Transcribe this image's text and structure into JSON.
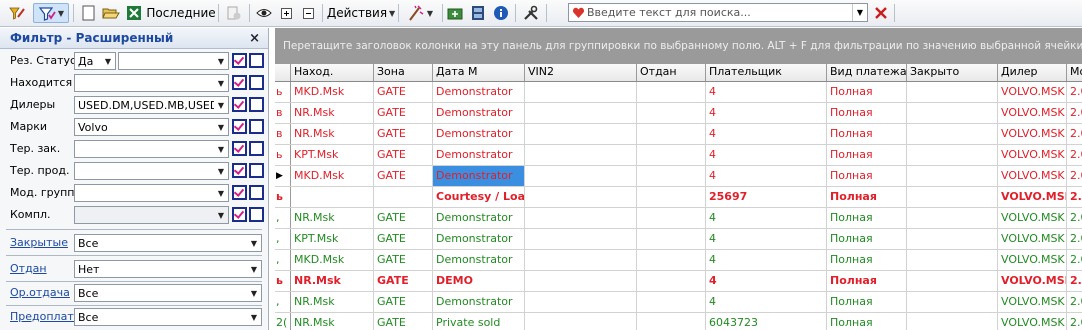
{
  "toolbar": {
    "recent_label": "Последние",
    "actions_label": "Действия",
    "search_placeholder": "Введите текст для поиска..."
  },
  "filter_panel": {
    "title": "Фильтр - Расширенный",
    "rows": [
      {
        "label": "Рез. Статус",
        "value": "Да",
        "value2": ""
      },
      {
        "label": "Находится",
        "value": ""
      },
      {
        "label": "Дилеры",
        "value": "USED.DM,USED.MB,USED.."
      },
      {
        "label": "Марки",
        "value": "Volvo"
      },
      {
        "label": "Тер. зак.",
        "value": ""
      },
      {
        "label": "Тер. прод.",
        "value": ""
      },
      {
        "label": "Мод. группа",
        "value": ""
      },
      {
        "label": "Компл.",
        "value": ""
      }
    ],
    "link_rows": [
      {
        "label": "Закрытые",
        "value": "Все"
      },
      {
        "label": "Отдан",
        "value": "Нет"
      },
      {
        "label": "Ор.отдача",
        "value": "Все"
      },
      {
        "label": "Предоплата",
        "value": "Все"
      }
    ]
  },
  "group_panel_hint": "Перетащите заголовок колонки на эту панель для группировки по выбранному полю. ALT + F для фильтрации по значению выбранной ячейки",
  "grid": {
    "columns": [
      "Наход.",
      "Зона",
      "Дата М",
      "VIN2",
      "Отдан",
      "Плательщик",
      "Вид платежа",
      "Закрыто",
      "Дилер",
      "Мо"
    ],
    "rows": [
      {
        "lead": "ь",
        "cells": [
          "MKD.Msk",
          "GATE",
          "Demonstrator",
          "",
          "",
          "4",
          "Полная",
          "",
          "VOLVO.MSK",
          "2.0"
        ],
        "style": "red"
      },
      {
        "lead": "в",
        "cells": [
          "NR.Msk",
          "GATE",
          "Demonstrator",
          "",
          "",
          "4",
          "Полная",
          "",
          "VOLVO.MSK",
          "2.0"
        ],
        "style": "red"
      },
      {
        "lead": "в",
        "cells": [
          "NR.Msk",
          "GATE",
          "Demonstrator",
          "",
          "",
          "4",
          "Полная",
          "",
          "VOLVO.MSK",
          "2.0"
        ],
        "style": "red"
      },
      {
        "lead": "ь",
        "cells": [
          "KPT.Msk",
          "GATE",
          "Demonstrator",
          "",
          "",
          "4",
          "Полная",
          "",
          "VOLVO.MSK",
          "2.0"
        ],
        "style": "red"
      },
      {
        "lead": "▶",
        "cells": [
          "MKD.Msk",
          "GATE",
          "Demonstrator",
          "",
          "",
          "4",
          "Полная",
          "",
          "VOLVO.MSK",
          "2.0"
        ],
        "style": "red",
        "selected_col": 2
      },
      {
        "lead": "ь",
        "cells": [
          "",
          "",
          "Courtesy / Loan",
          "",
          "",
          "25697",
          "Полная",
          "",
          "VOLVO.MSK",
          "2."
        ],
        "style": "red bold"
      },
      {
        "lead": ",",
        "cells": [
          "NR.Msk",
          "GATE",
          "Demonstrator",
          "",
          "",
          "4",
          "Полная",
          "",
          "VOLVO.MSK",
          "2.0"
        ],
        "style": "green"
      },
      {
        "lead": ",",
        "cells": [
          "KPT.Msk",
          "GATE",
          "Demonstrator",
          "",
          "",
          "4",
          "Полная",
          "",
          "VOLVO.MSK",
          "2.0"
        ],
        "style": "green"
      },
      {
        "lead": ",",
        "cells": [
          "MKD.Msk",
          "GATE",
          "Demonstrator",
          "",
          "",
          "4",
          "Полная",
          "",
          "VOLVO.MSK",
          "2.0"
        ],
        "style": "green"
      },
      {
        "lead": "ь",
        "cells": [
          "NR.Msk",
          "GATE",
          "DEMO",
          "",
          "",
          "4",
          "Полная",
          "",
          "VOLVO.MSK",
          "2."
        ],
        "style": "red bold"
      },
      {
        "lead": ",",
        "cells": [
          "NR.Msk",
          "GATE",
          "Demonstrator",
          "",
          "",
          "4",
          "Полная",
          "",
          "VOLVO.MSK",
          "2.0"
        ],
        "style": "green"
      },
      {
        "lead": "2(",
        "cells": [
          "NR.Msk",
          "GATE",
          "Private sold",
          "",
          "",
          "6043723",
          "Полная",
          "",
          "VOLVO.MSK",
          "2.0"
        ],
        "style": "green"
      }
    ]
  }
}
